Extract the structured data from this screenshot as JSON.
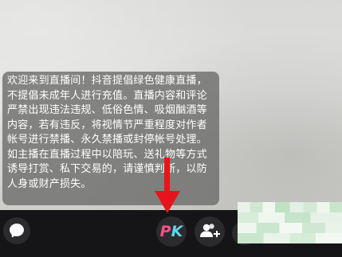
{
  "live_room": {
    "notice_text": "欢迎来到直播间！抖音提倡绿色健康直播，不提倡未成年人进行充值。直播内容和评论严禁出现违法违规、低俗色情、吸烟酗酒等内容，若有违反，将视情节严重程度对作者帐号进行禁播、永久禁播或封停帐号处理。如主播在直播过程中以陪玩、送礼物等方式诱导打赏、私下交易的，请谨慎判断，以防人身或财产损失。"
  },
  "bottom_bar": {
    "pk_label_p": "P",
    "pk_label_k": "K"
  },
  "colors": {
    "bar_background": "#151517",
    "pk_p": "#ff4f8b",
    "pk_k": "#5fd3e6",
    "arrow": "#e8141b",
    "notice_background": "#6e6e6c"
  },
  "icons": {
    "chat": "chat-bubble-icon",
    "pk": "pk-icon",
    "add_friend": "add-friend-icon",
    "arrow": "red-arrow-annotation"
  }
}
